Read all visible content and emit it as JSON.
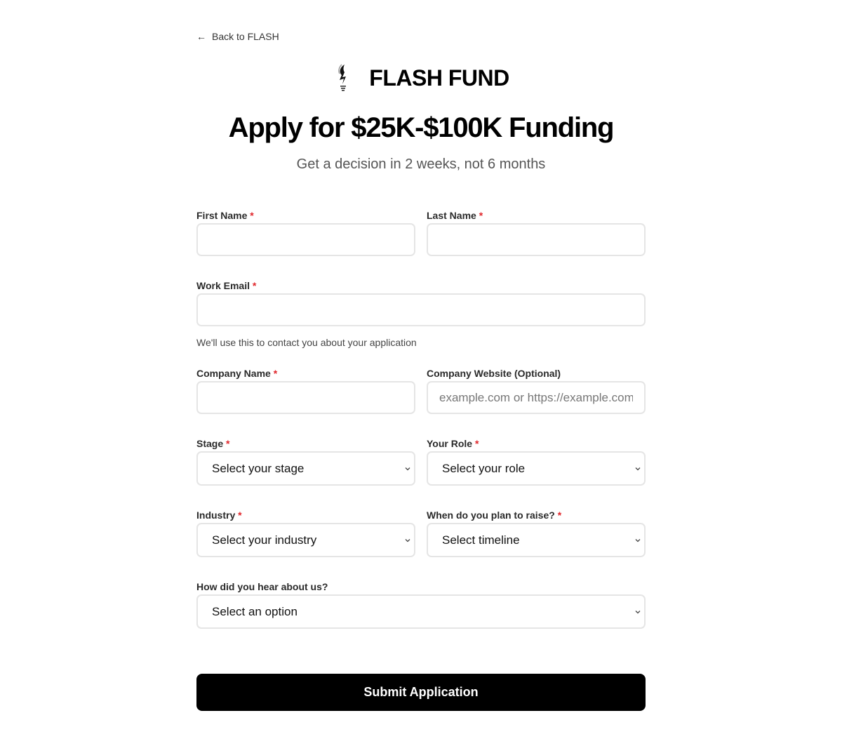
{
  "nav": {
    "back_label": "Back to FLASH"
  },
  "brand": {
    "name": "FLASH FUND",
    "logo_icon": "torch-bolt-logo"
  },
  "hero": {
    "title": "Apply for $25K-$100K Funding",
    "subtitle": "Get a decision in 2 weeks, not 6 months"
  },
  "form": {
    "required_mark": "*",
    "first_name": {
      "label": "First Name",
      "value": "",
      "placeholder": ""
    },
    "last_name": {
      "label": "Last Name",
      "value": "",
      "placeholder": ""
    },
    "work_email": {
      "label": "Work Email",
      "value": "",
      "placeholder": "",
      "helper": "We'll use this to contact you about your application"
    },
    "company_name": {
      "label": "Company Name",
      "value": "",
      "placeholder": ""
    },
    "company_website": {
      "label": "Company Website (Optional)",
      "value": "",
      "placeholder": "example.com or https://example.com"
    },
    "stage": {
      "label": "Stage",
      "selected": "Select your stage"
    },
    "role": {
      "label": "Your Role",
      "selected": "Select your role"
    },
    "industry": {
      "label": "Industry",
      "selected": "Select your industry"
    },
    "timeline": {
      "label": "When do you plan to raise?",
      "selected": "Select timeline"
    },
    "referral": {
      "label": "How did you hear about us?",
      "selected": "Select an option"
    },
    "submit_label": "Submit Application"
  },
  "colors": {
    "required": "#e0262b",
    "button_bg": "#000000",
    "input_border": "#e5e5e5"
  }
}
